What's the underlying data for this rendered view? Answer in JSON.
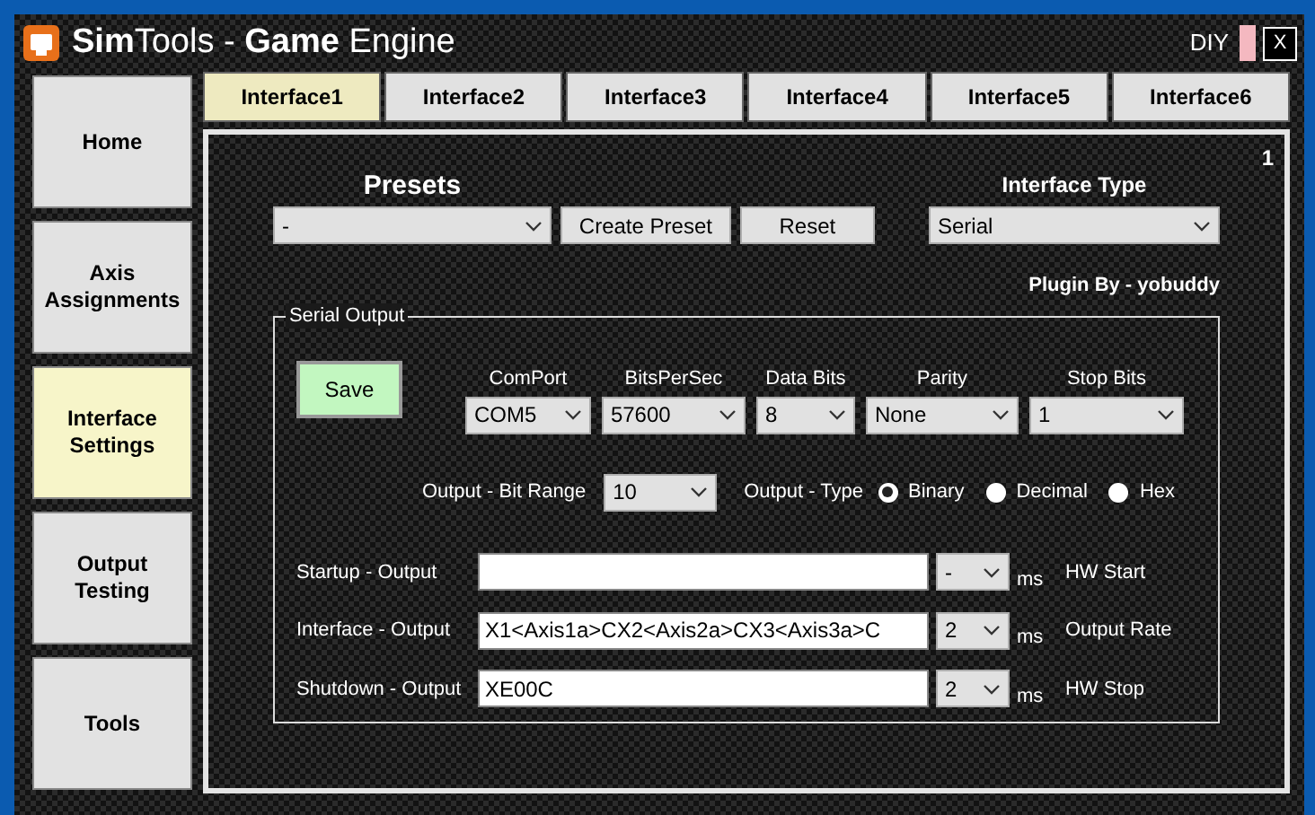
{
  "window": {
    "title": "**Sim**Tools - **Game** Engine",
    "mode_label": "DIY",
    "close_label": "X"
  },
  "sidebar": {
    "items": [
      {
        "label": "Home",
        "selected": false
      },
      {
        "label": "Axis Assignments",
        "selected": false
      },
      {
        "label": "Interface Settings",
        "selected": true
      },
      {
        "label": "Output Testing",
        "selected": false
      },
      {
        "label": "Tools",
        "selected": false
      }
    ]
  },
  "tabs": [
    {
      "label": "Interface1",
      "selected": true
    },
    {
      "label": "Interface2",
      "selected": false
    },
    {
      "label": "Interface3",
      "selected": false
    },
    {
      "label": "Interface4",
      "selected": false
    },
    {
      "label": "Interface5",
      "selected": false
    },
    {
      "label": "Interface6",
      "selected": false
    }
  ],
  "panel": {
    "number": "1",
    "presets": {
      "label": "Presets",
      "value": "-",
      "buttons": [
        "Create Preset",
        "Reset"
      ]
    },
    "interface_type": {
      "label": "Interface Type",
      "value": "Serial"
    },
    "plugin_by": "Plugin By - yobuddy",
    "serial_output": {
      "title": "Serial Output",
      "save_button": "Save",
      "settings": [
        {
          "label": "ComPort",
          "value": "COM5"
        },
        {
          "label": "BitsPerSec",
          "value": "57600"
        },
        {
          "label": "Data Bits",
          "value": "8"
        },
        {
          "label": "Parity",
          "value": "None"
        },
        {
          "label": "Stop Bits",
          "value": "1"
        }
      ],
      "bit_range": {
        "label": "Output - Bit Range",
        "value": "10"
      },
      "output_type": {
        "label": "Output - Type",
        "options": [
          {
            "label": "Binary",
            "selected": true
          },
          {
            "label": "Decimal",
            "selected": false
          },
          {
            "label": "Hex",
            "selected": false
          }
        ]
      },
      "outputs": [
        {
          "label": "Startup - Output",
          "rate": "-",
          "unit": "ms",
          "note": "HW Start"
        },
        {
          "label": "Interface - Output",
          "value": "X1<Axis1a>CX2<Axis2a>CX3<Axis3a>C",
          "rate": "2",
          "unit": "ms",
          "note": "Output Rate"
        },
        {
          "label": "Shutdown - Output",
          "value": "XE00C",
          "rate": "2",
          "unit": "ms",
          "note": "HW Stop"
        }
      ]
    }
  }
}
